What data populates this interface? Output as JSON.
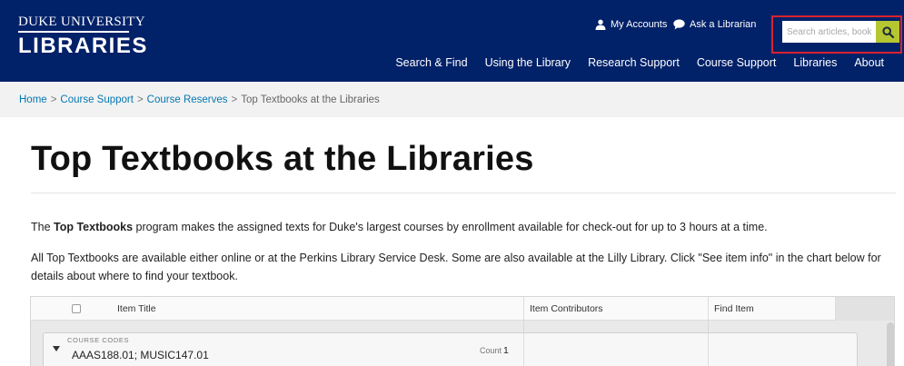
{
  "header": {
    "logo_top": "DUKE UNIVERSITY",
    "logo_main": "LIBRARIES",
    "utility": {
      "accounts": "My Accounts",
      "librarian": "Ask a Librarian"
    },
    "search": {
      "placeholder": "Search articles, books",
      "button_icon": "search-icon"
    },
    "nav": [
      "Search & Find",
      "Using the Library",
      "Research Support",
      "Course Support",
      "Libraries",
      "About"
    ]
  },
  "breadcrumb": {
    "home": "Home",
    "sep": ">",
    "course_support": "Course Support",
    "course_reserves": "Course Reserves",
    "current": "Top Textbooks at the Libraries"
  },
  "page": {
    "title": "Top Textbooks at the Libraries",
    "para1": {
      "lead": "The ",
      "bold": "Top Textbooks",
      "rest": " program makes the assigned texts for Duke's largest courses by enrollment available for check-out for up to 3 hours at a time."
    },
    "para2": "All Top Textbooks are available either online or at the Perkins Library Service Desk.  Some are also available at the Lilly Library.  Click \"See item info\" in the chart below for details about where to find your textbook."
  },
  "table": {
    "columns": {
      "title": "Item Title",
      "contributors": "Item Contributors",
      "find": "Find Item"
    },
    "group": {
      "label": "COURSE CODES",
      "value": "AAAS188.01; MUSIC147.01",
      "count_label": "Count",
      "count_value": "1"
    }
  },
  "colors": {
    "header_bg": "#012169",
    "search_outline": "#d9232e",
    "search_button": "#b5c631",
    "link": "#0577b1"
  }
}
